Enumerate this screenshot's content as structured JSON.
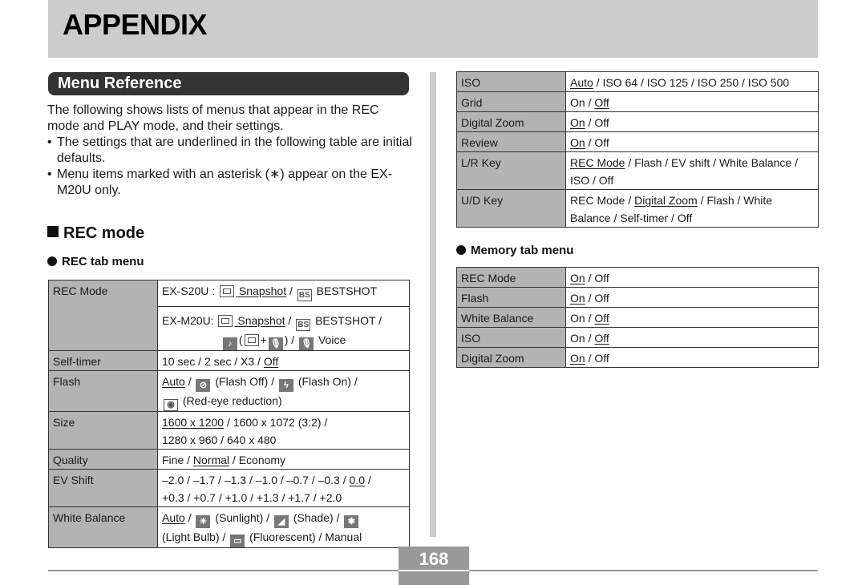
{
  "header": {
    "title": "APPENDIX"
  },
  "section": {
    "title": "Menu Reference"
  },
  "intro": {
    "paragraph": "The following shows lists of menus that appear in the REC mode and PLAY mode, and their settings.",
    "bullets": [
      "The settings that are underlined in the following table are initial defaults.",
      "Menu items marked with an asterisk (∗) appear on the EX-M20U only."
    ]
  },
  "rec_mode": {
    "heading": "REC mode",
    "rec_tab": {
      "heading": "REC tab menu",
      "rec_mode_label": "REC Mode",
      "rec_mode_s20u_prefix": "EX-S20U :",
      "rec_mode_m20u_prefix": "EX-M20U:",
      "snapshot": "Snapshot",
      "bestshot": "BESTSHOT",
      "voice": "Voice",
      "self_timer_label": "Self-timer",
      "self_timer_options": "10 sec / 2 sec / X3 / ",
      "self_timer_default": "Off",
      "flash_label": "Flash",
      "flash_default": "Auto",
      "flash_off": "(Flash Off)",
      "flash_on": "(Flash On)",
      "flash_redeye": "(Red-eye reduction)",
      "size_label": "Size",
      "size_default": "1600 x 1200",
      "size_rest_line1": " / 1600 x 1072 (3:2) /",
      "size_line2": "1280 x 960 / 640 x 480",
      "quality_label": "Quality",
      "quality_pre": "Fine / ",
      "quality_default": "Normal",
      "quality_post": " / Economy",
      "ev_label": "EV Shift",
      "ev_line1_pre": "–2.0 / –1.7 / –1.3 / –1.0 / –0.7 / –0.3 / ",
      "ev_default": "0.0",
      "ev_line1_post": " /",
      "ev_line2": "+0.3 / +0.7 / +1.0 / +1.3 / +1.7 / +2.0",
      "wb_label": "White Balance",
      "wb_default": "Auto",
      "wb_sunlight": "(Sunlight) /",
      "wb_shade": "(Shade) /",
      "wb_lightbulb": "(Light Bulb) /",
      "wb_fluorescent": "(Fluorescent) / Manual"
    },
    "rec_tab_cont": {
      "iso_label": "ISO",
      "iso_default": "Auto",
      "iso_rest": " / ISO 64 / ISO 125 / ISO 250 / ISO 500",
      "grid_label": "Grid",
      "grid_pre": "On / ",
      "grid_default": "Off",
      "dzoom_label": "Digital Zoom",
      "dzoom_default": "On",
      "dzoom_post": " / Off",
      "review_label": "Review",
      "review_default": "On",
      "review_post": " / Off",
      "lr_label": "L/R Key",
      "lr_default": "REC Mode",
      "lr_rest": " / Flash / EV shift / White Balance / ISO / Off",
      "ud_label": "U/D Key",
      "ud_pre": "REC Mode / ",
      "ud_default": "Digital Zoom",
      "ud_rest": " / Flash / White Balance / Self-timer / Off"
    },
    "memory_tab": {
      "heading": "Memory tab menu",
      "rows": [
        {
          "label": "REC Mode",
          "on": "On",
          "sep": " / ",
          "off": "Off",
          "default": "on"
        },
        {
          "label": "Flash",
          "on": "On",
          "sep": " / ",
          "off": "Off",
          "default": "on"
        },
        {
          "label": "White Balance",
          "on": "On",
          "sep": " / ",
          "off": "Off",
          "default": "off"
        },
        {
          "label": "ISO",
          "on": "On",
          "sep": " / ",
          "off": "Off",
          "default": "off"
        },
        {
          "label": "Digital Zoom",
          "on": "On",
          "sep": " / ",
          "off": "Off",
          "default": "on"
        }
      ]
    }
  },
  "icons": {
    "bs": "BS",
    "plus": "+",
    "slash": " / ",
    "open_paren": " (",
    "close_paren": ") / "
  },
  "footer": {
    "page_number": "168"
  }
}
